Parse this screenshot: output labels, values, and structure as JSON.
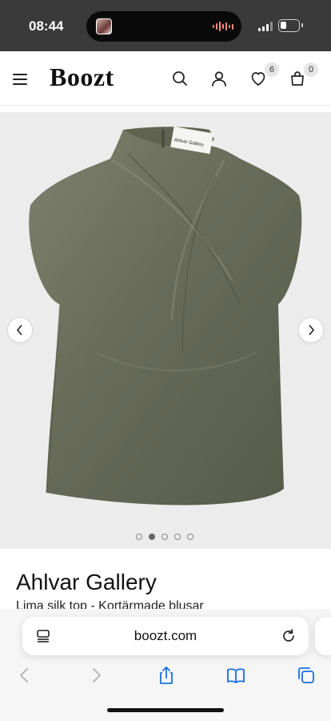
{
  "status_bar": {
    "time": "08:44",
    "battery_level": 0.35,
    "signal_bars": 4,
    "signal_bars_active": 3
  },
  "header": {
    "logo": "Boozt",
    "wishlist_count": "6",
    "cart_count": "0"
  },
  "gallery": {
    "image_count": 5,
    "active_index": 1,
    "product_color": "#676b58"
  },
  "product": {
    "brand": "Ahlvar Gallery",
    "name": "Lima silk top - Kortärmade blusar",
    "label_text": "Ahlvar Gallery"
  },
  "browser": {
    "url": "boozt.com"
  },
  "icons": [
    "menu-icon",
    "search-icon",
    "account-icon",
    "heart-icon",
    "bag-icon",
    "chevron-left-icon",
    "chevron-right-icon",
    "reader-icon",
    "reload-icon",
    "back-icon",
    "forward-icon",
    "share-icon",
    "bookmarks-icon",
    "tabs-icon"
  ]
}
